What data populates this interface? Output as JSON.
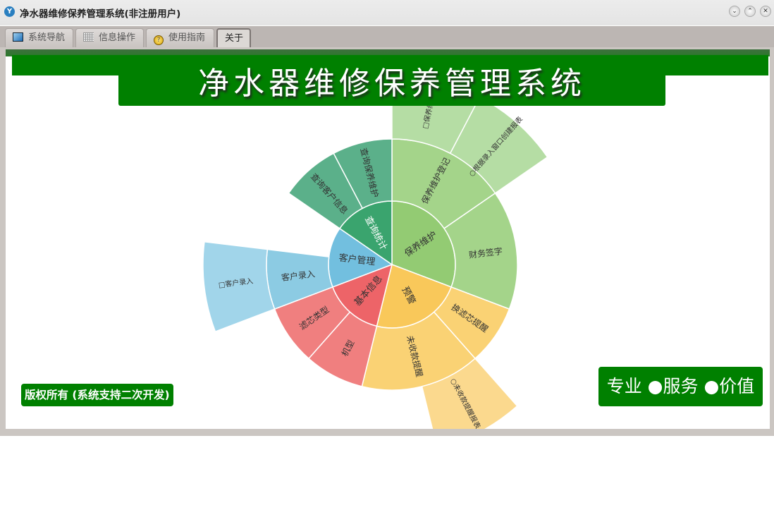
{
  "window": {
    "title": "净水器维修保养管理系统(非注册用户)",
    "controls": [
      "minimize",
      "maximize",
      "close"
    ]
  },
  "tabs": [
    {
      "label": "系统导航",
      "icon": "monitor-icon",
      "active": false
    },
    {
      "label": "信息操作",
      "icon": "grid-icon",
      "active": false
    },
    {
      "label": "使用指南",
      "icon": "help-icon",
      "active": false
    },
    {
      "label": "关于",
      "icon": "",
      "active": true
    }
  ],
  "header": {
    "title": "净水器维修保养管理系统",
    "color": "#008000"
  },
  "footer": {
    "copyright": "版权所有 (系统支持二次开发)",
    "slogan": "专业 ●服务 ●价值"
  },
  "chart_data": {
    "type": "sunburst",
    "children": [
      {
        "name": "保养维护",
        "value": 4,
        "colors": [
          "#93cb73",
          "#a4d48a",
          "#b5dda4"
        ],
        "children": [
          {
            "name": "保养维护登记",
            "value": 2,
            "children": [
              {
                "name": "□保养维护",
                "value": 1
              },
              {
                "name": "○根据录入窗口创建报表",
                "value": 1
              }
            ]
          },
          {
            "name": "财务签字",
            "value": 2
          }
        ]
      },
      {
        "name": "预警",
        "value": 3,
        "colors": [
          "#f9c85a",
          "#fad274",
          "#fbd98e"
        ],
        "children": [
          {
            "name": "换滤芯提醒",
            "value": 1
          },
          {
            "name": "未收款提醒",
            "value": 2,
            "children": [
              {
                "name": "○未收款提醒报表",
                "value": 1
              }
            ]
          }
        ]
      },
      {
        "name": "基本信息",
        "value": 2,
        "colors": [
          "#ed6468",
          "#f07f7f",
          "#f49c9c"
        ],
        "children": [
          {
            "name": "机型",
            "value": 1
          },
          {
            "name": "滤芯类型",
            "value": 1
          }
        ]
      },
      {
        "name": "客户管理",
        "value": 2,
        "colors": [
          "#72bfdf",
          "#8ccbe3",
          "#a1d5ea"
        ],
        "children": [
          {
            "name": "客户录入",
            "value": 1,
            "children": [
              {
                "name": "□客户录入",
                "value": 1
              }
            ]
          }
        ]
      },
      {
        "name": "查询统计",
        "value": 2,
        "colors": [
          "#3aa46e",
          "#5bb08a",
          "#7cc0a0"
        ],
        "children": [
          {
            "name": "查询客户信息",
            "value": 1
          },
          {
            "name": "查询保养维护",
            "value": 1
          }
        ]
      }
    ]
  }
}
